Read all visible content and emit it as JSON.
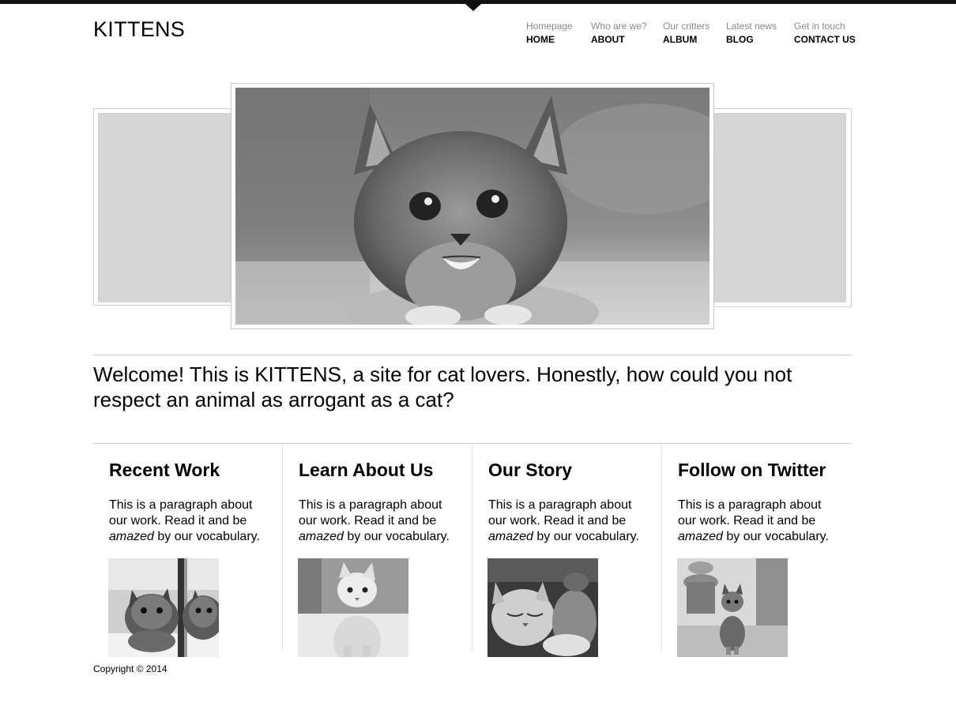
{
  "site": {
    "logo": "KITTENS"
  },
  "nav": [
    {
      "sub": "Homepage",
      "label": "HOME"
    },
    {
      "sub": "Who are we?",
      "label": "ABOUT"
    },
    {
      "sub": "Our critters",
      "label": "ALBUM"
    },
    {
      "sub": "Latest news",
      "label": "BLOG"
    },
    {
      "sub": "Get in touch",
      "label": "CONTACT US"
    }
  ],
  "welcome": "Welcome! This is KITTENS, a site for cat lovers. Honestly, how could you not respect an animal as arrogant as a cat?",
  "columns": [
    {
      "title": "Recent Work",
      "text_before": "This is a paragraph about our work. Read it and be ",
      "emphasis": "amazed",
      "text_after": " by our vocabulary."
    },
    {
      "title": "Learn About Us",
      "text_before": "This is a paragraph about our work. Read it and be ",
      "emphasis": "amazed",
      "text_after": " by our vocabulary."
    },
    {
      "title": "Our Story",
      "text_before": "This is a paragraph about our work. Read it and be ",
      "emphasis": "amazed",
      "text_after": " by our vocabulary."
    },
    {
      "title": "Follow on Twitter",
      "text_before": "This is a paragraph about our work. Read it and be ",
      "emphasis": "amazed",
      "text_after": " by our vocabulary."
    }
  ],
  "footer": {
    "copyright": "Copyright © 2014"
  },
  "colors": {
    "topbar": "#111111",
    "slider_panel": "#d5d5d5",
    "divider": "#cccccc",
    "nav_sub": "#8a8a8a"
  }
}
